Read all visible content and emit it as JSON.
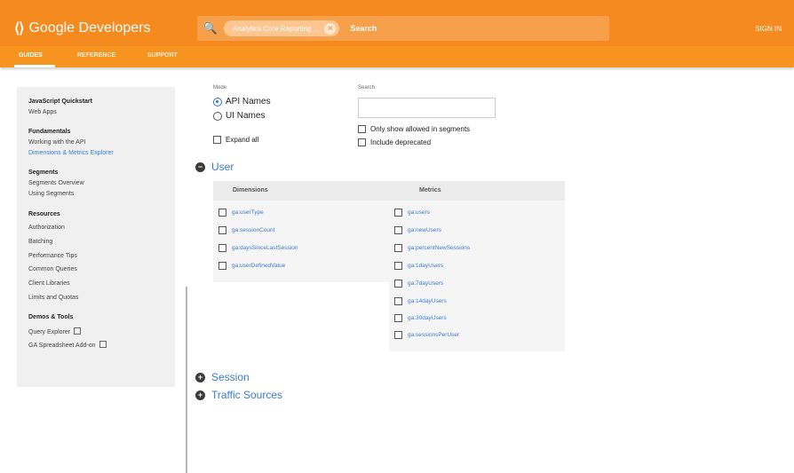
{
  "header": {
    "brand_logo": "⟨⟩",
    "brand_name": "Google Developers",
    "search_chip": "Analytics Core Reporting ...",
    "search_label": "Search",
    "signin": "SIGN IN"
  },
  "nav": {
    "tabs": [
      "GUIDES",
      "REFERENCE",
      "SUPPORT"
    ],
    "active": "GUIDES"
  },
  "sidebar": {
    "items": [
      {
        "label": "JavaScript Quickstart",
        "type": "head"
      },
      {
        "label": "Web Apps",
        "type": "link"
      },
      {
        "label": "Fundamentals",
        "type": "head"
      },
      {
        "label": "Working with the API",
        "type": "link"
      },
      {
        "label": "Dimensions & Metrics Explorer",
        "type": "active"
      },
      {
        "label": "Segments",
        "type": "head"
      },
      {
        "label": "Segments Overview",
        "type": "link"
      },
      {
        "label": "Using Segments",
        "type": "link"
      },
      {
        "label": "Resources",
        "type": "head"
      },
      {
        "label": "Authorization",
        "type": "link"
      },
      {
        "label": "Batching",
        "type": "link"
      },
      {
        "label": "Performance Tips",
        "type": "link"
      },
      {
        "label": "Common Queries",
        "type": "link"
      },
      {
        "label": "Client Libraries",
        "type": "link"
      },
      {
        "label": "Limits and Quotas",
        "type": "link"
      },
      {
        "label": "Demos & Tools",
        "type": "head"
      },
      {
        "label": "Query Explorer",
        "type": "external"
      },
      {
        "label": "GA Spreadsheet Add-on",
        "type": "external"
      }
    ]
  },
  "controls": {
    "mode_label": "Mode",
    "mode_options": [
      "API Names",
      "UI Names"
    ],
    "mode_selected": "API Names",
    "expand_all": "Expand all",
    "search_label": "Search",
    "search_value": "",
    "only_allowed": "Only show allowed in segments",
    "include_deprecated": "Include deprecated"
  },
  "sections": {
    "user": "User",
    "session": "Session",
    "traffic": "Traffic Sources"
  },
  "user_table": {
    "dimensions_header": "Dimensions",
    "metrics_header": "Metrics",
    "dimensions": [
      "ga:userType",
      "ga:sessionCount",
      "ga:daysSinceLastSession",
      "ga:userDefinedValue"
    ],
    "metrics": [
      "ga:users",
      "ga:newUsers",
      "ga:percentNewSessions",
      "ga:1dayUsers",
      "ga:7dayUsers",
      "ga:14dayUsers",
      "ga:30dayUsers",
      "ga:sessionsPerUser"
    ]
  },
  "colors": {
    "header": "#f58a1f",
    "link": "#3a7bd5"
  }
}
